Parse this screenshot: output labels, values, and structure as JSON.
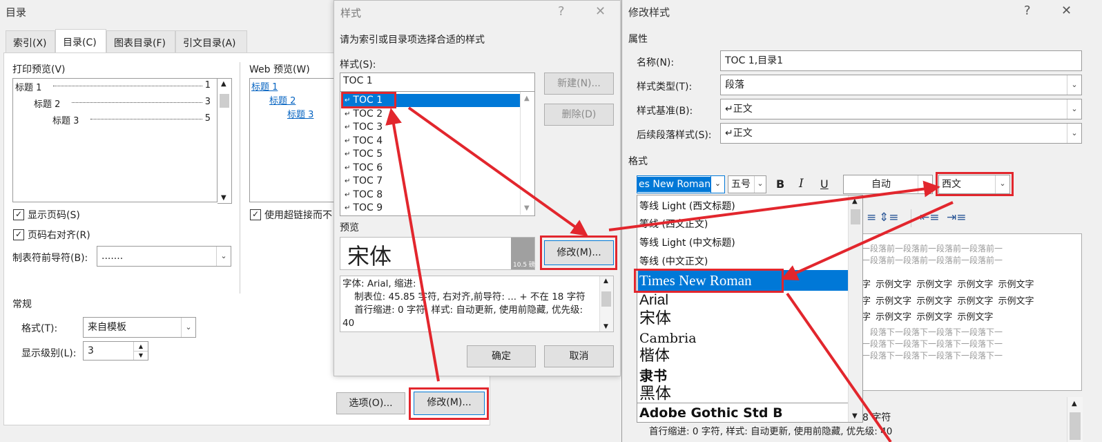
{
  "toc_dialog": {
    "title": "目录",
    "tabs": [
      "索引(X)",
      "目录(C)",
      "图表目录(F)",
      "引文目录(A)"
    ],
    "print_preview_label": "打印预览(V)",
    "print_preview_lines": [
      {
        "text": "标题 1",
        "page": "1"
      },
      {
        "text": "标题 2",
        "page": "3"
      },
      {
        "text": "标题 3",
        "page": "5"
      }
    ],
    "web_preview_label": "Web 预览(W)",
    "web_preview_links": [
      "标题 1",
      "标题 2",
      "标题 3"
    ],
    "show_page_numbers": "显示页码(S)",
    "right_align": "页码右对齐(R)",
    "tab_leader_label": "制表符前导符(B):",
    "tab_leader_value": ".......",
    "use_hyperlinks": "使用超链接而不",
    "general_label": "常规",
    "format_label": "格式(T):",
    "format_value": "来自模板",
    "levels_label": "显示级别(L):",
    "levels_value": "3",
    "options_button": "选项(O)...",
    "modify_button": "修改(M)..."
  },
  "style_dialog": {
    "title": "样式",
    "help": "?",
    "close": "✕",
    "instruction": "请为索引或目录项选择合适的样式",
    "styles_label": "样式(S):",
    "styles_input": "TOC 1",
    "styles_list": [
      "TOC 1",
      "TOC 2",
      "TOC 3",
      "TOC 4",
      "TOC 5",
      "TOC 6",
      "TOC 7",
      "TOC 8",
      "TOC 9"
    ],
    "new_button": "新建(N)...",
    "delete_button": "删除(D)",
    "preview_label": "预览",
    "preview_font": "宋体",
    "preview_size": "10.5 磅",
    "modify_button": "修改(M)...",
    "description": "字体: Arial, 缩进:\n    制表位: 45.85 字符, 右对齐,前导符: ... + 不在 18 字符\n    首行缩进: 0 字符, 样式: 自动更新, 使用前隐藏, 优先级:\n40",
    "ok_button": "确定",
    "cancel_button": "取消"
  },
  "modify_dialog": {
    "title": "修改样式",
    "help": "?",
    "close": "✕",
    "properties_label": "属性",
    "name_label": "名称(N):",
    "name_value": "TOC 1,目录1",
    "style_type_label": "样式类型(T):",
    "style_type_value": "段落",
    "based_on_label": "样式基准(B):",
    "based_on_value": "↵正文",
    "next_style_label": "后续段落样式(S):",
    "next_style_value": "↵正文",
    "format_label": "格式",
    "font_value": "es New Roman",
    "size_value": "五号",
    "bold": "B",
    "italic": "I",
    "underline": "U",
    "color_value": "自动",
    "script_value": "西文",
    "font_list": [
      "等线 Light (西文标题)",
      "等线 (西文正文)",
      "等线 Light (中文标题)",
      "等线 (中文正文)",
      "Times New Roman",
      "Arial",
      "宋体",
      "Cambria",
      "楷体",
      "隶书",
      "黑体",
      "Adobe Gothic Std B"
    ],
    "preview_before": [
      "一段落前一段落前一段落前一段落前一",
      "一段落前一段落前一段落前一段落前一"
    ],
    "sample_lines": [
      "字 示例文字 示例文字 示例文字 示例文字",
      "字 示例文字 示例文字 示例文字 示例文字",
      "字 示例文字 示例文字 示例文字"
    ],
    "preview_after": [
      "段落下一段落下一段落下一段落下一",
      "一段落下一段落下一段落下一段落下一",
      "一段落下一段落下一段落下一段落下一"
    ],
    "desc_line1": "8 字符",
    "desc_line2": "首行缩进: 0 字符, 样式: 自动更新, 使用前隐藏, 优先级: 40"
  },
  "colors": {
    "accent": "#0078d7",
    "highlight_red": "#e2262d",
    "link": "#0563c1"
  }
}
